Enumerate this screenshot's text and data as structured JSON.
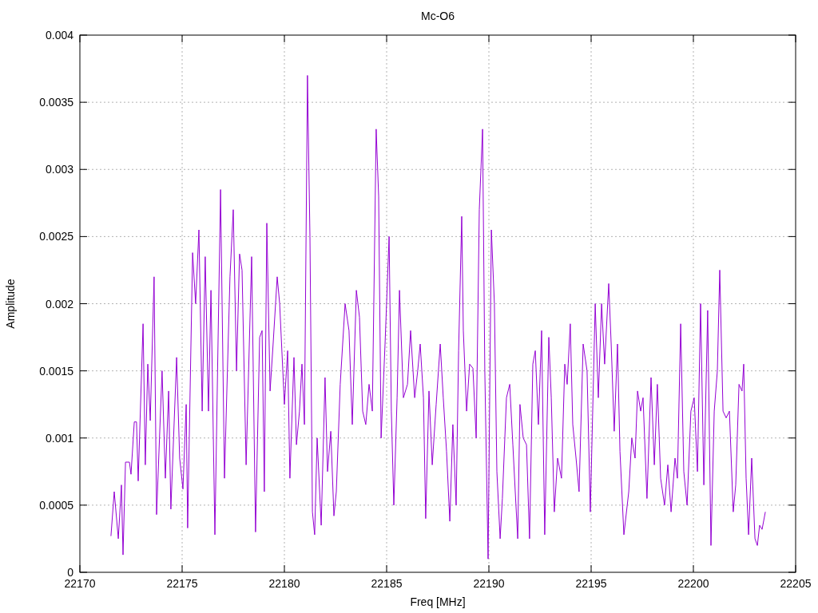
{
  "chart_data": {
    "type": "line",
    "grid": true,
    "title": "Mc-O6",
    "xlabel": "Freq [MHz]",
    "ylabel": "Amplitude",
    "xlim": [
      22170,
      22205
    ],
    "ylim": [
      0,
      0.004
    ],
    "xticks": [
      22170,
      22175,
      22180,
      22185,
      22190,
      22195,
      22200,
      22205
    ],
    "yticks": [
      0,
      0.0005,
      0.001,
      0.0015,
      0.002,
      0.0025,
      0.003,
      0.0035,
      0.004
    ],
    "x": [
      22171.52,
      22171.68,
      22171.88,
      22172.03,
      22172.11,
      22172.23,
      22172.42,
      22172.5,
      22172.66,
      22172.77,
      22172.85,
      22173.09,
      22173.2,
      22173.32,
      22173.44,
      22173.63,
      22173.75,
      22174.02,
      22174.18,
      22174.34,
      22174.45,
      22174.73,
      22174.88,
      22175.04,
      22175.2,
      22175.27,
      22175.51,
      22175.66,
      22175.82,
      22175.98,
      22176.13,
      22176.29,
      22176.41,
      22176.6,
      22176.88,
      22177.07,
      22177.34,
      22177.5,
      22177.66,
      22177.81,
      22177.93,
      22178.13,
      22178.4,
      22178.59,
      22178.79,
      22178.91,
      22179.02,
      22179.14,
      22179.3,
      22179.45,
      22179.65,
      22179.77,
      22180.0,
      22180.16,
      22180.27,
      22180.47,
      22180.59,
      22180.74,
      22180.86,
      22180.98,
      22181.13,
      22181.25,
      22181.37,
      22181.48,
      22181.6,
      22181.8,
      22181.99,
      22182.11,
      22182.27,
      22182.42,
      22182.54,
      22182.73,
      22182.97,
      22183.16,
      22183.32,
      22183.52,
      22183.67,
      22183.83,
      22183.98,
      22184.14,
      22184.3,
      22184.49,
      22184.61,
      22184.73,
      22184.92,
      22185.12,
      22185.23,
      22185.35,
      22185.51,
      22185.63,
      22185.82,
      22186.02,
      22186.17,
      22186.37,
      22186.52,
      22186.64,
      22186.8,
      22186.91,
      22187.07,
      22187.23,
      22187.42,
      22187.62,
      22187.77,
      22187.93,
      22188.09,
      22188.24,
      22188.4,
      22188.52,
      22188.67,
      22188.75,
      22188.91,
      22189.06,
      22189.22,
      22189.38,
      22189.53,
      22189.69,
      22189.8,
      22189.96,
      22190.12,
      22190.27,
      22190.39,
      22190.55,
      22190.66,
      22190.86,
      22191.02,
      22191.17,
      22191.29,
      22191.41,
      22191.52,
      22191.68,
      22191.84,
      22191.99,
      22192.15,
      22192.27,
      22192.42,
      22192.58,
      22192.73,
      22192.93,
      22193.05,
      22193.2,
      22193.36,
      22193.55,
      22193.71,
      22193.83,
      22193.98,
      22194.1,
      22194.26,
      22194.41,
      22194.61,
      22194.8,
      22194.96,
      22195.2,
      22195.35,
      22195.51,
      22195.66,
      22195.86,
      22195.98,
      22196.13,
      22196.29,
      22196.41,
      22196.6,
      22196.84,
      22196.99,
      22197.15,
      22197.27,
      22197.42,
      22197.54,
      22197.73,
      22197.93,
      22198.09,
      22198.24,
      22198.4,
      22198.59,
      22198.75,
      22198.91,
      22199.1,
      22199.22,
      22199.38,
      22199.53,
      22199.69,
      22199.88,
      22200.04,
      22200.2,
      22200.35,
      22200.51,
      22200.7,
      22200.86,
      22201.02,
      22201.17,
      22201.29,
      22201.45,
      22201.6,
      22201.76,
      22201.95,
      22202.07,
      22202.23,
      22202.38,
      22202.46,
      22202.58,
      22202.7,
      22202.85,
      22203.01,
      22203.13,
      22203.24,
      22203.36,
      22203.52
    ],
    "series": [
      {
        "color": "#9400d3",
        "values": [
          0.00027,
          0.0006,
          0.00025,
          0.00065,
          0.00013,
          0.00082,
          0.00082,
          0.00073,
          0.00112,
          0.00112,
          0.00068,
          0.00185,
          0.0008,
          0.00155,
          0.00113,
          0.0022,
          0.00043,
          0.0015,
          0.0007,
          0.00135,
          0.00047,
          0.0016,
          0.00085,
          0.00062,
          0.00125,
          0.00033,
          0.00238,
          0.002,
          0.00255,
          0.0012,
          0.00235,
          0.0012,
          0.0021,
          0.00028,
          0.00285,
          0.0007,
          0.0022,
          0.0027,
          0.0015,
          0.00237,
          0.00225,
          0.0008,
          0.00235,
          0.0003,
          0.00175,
          0.0018,
          0.0006,
          0.0026,
          0.00135,
          0.0017,
          0.0022,
          0.002,
          0.00125,
          0.00165,
          0.0007,
          0.0016,
          0.00095,
          0.0012,
          0.00155,
          0.0011,
          0.0037,
          0.0025,
          0.00045,
          0.00028,
          0.001,
          0.00035,
          0.00145,
          0.00075,
          0.00105,
          0.00042,
          0.0006,
          0.0014,
          0.002,
          0.0018,
          0.0011,
          0.0021,
          0.0019,
          0.0012,
          0.0011,
          0.0014,
          0.0012,
          0.0033,
          0.0028,
          0.001,
          0.0017,
          0.0025,
          0.0012,
          0.0005,
          0.0013,
          0.0021,
          0.0013,
          0.0014,
          0.0018,
          0.0013,
          0.0015,
          0.0017,
          0.0013,
          0.0004,
          0.00135,
          0.0008,
          0.00125,
          0.0017,
          0.0013,
          0.0009,
          0.00038,
          0.0011,
          0.0005,
          0.00165,
          0.00265,
          0.0018,
          0.0012,
          0.00155,
          0.00152,
          0.001,
          0.0027,
          0.0033,
          0.0015,
          0.0001,
          0.00255,
          0.002,
          0.00075,
          0.00025,
          0.00055,
          0.0013,
          0.0014,
          0.00095,
          0.0006,
          0.00025,
          0.00125,
          0.001,
          0.00095,
          0.00025,
          0.00155,
          0.00165,
          0.0011,
          0.0018,
          0.00028,
          0.00175,
          0.0013,
          0.00045,
          0.00085,
          0.0007,
          0.00155,
          0.0014,
          0.00185,
          0.0011,
          0.00085,
          0.0006,
          0.0017,
          0.0015,
          0.00045,
          0.002,
          0.0013,
          0.002,
          0.00155,
          0.00215,
          0.0017,
          0.00105,
          0.0017,
          0.0009,
          0.00028,
          0.0006,
          0.001,
          0.00085,
          0.00135,
          0.0012,
          0.0013,
          0.00055,
          0.00145,
          0.0008,
          0.0014,
          0.0007,
          0.0005,
          0.0008,
          0.00045,
          0.00085,
          0.0007,
          0.00185,
          0.00075,
          0.0005,
          0.0012,
          0.0013,
          0.00075,
          0.002,
          0.00065,
          0.00195,
          0.0002,
          0.0012,
          0.0015,
          0.00225,
          0.0012,
          0.00115,
          0.0012,
          0.00045,
          0.00065,
          0.0014,
          0.00135,
          0.00155,
          0.0007,
          0.00028,
          0.00085,
          0.00025,
          0.0002,
          0.00035,
          0.00032,
          0.00045
        ]
      }
    ]
  }
}
